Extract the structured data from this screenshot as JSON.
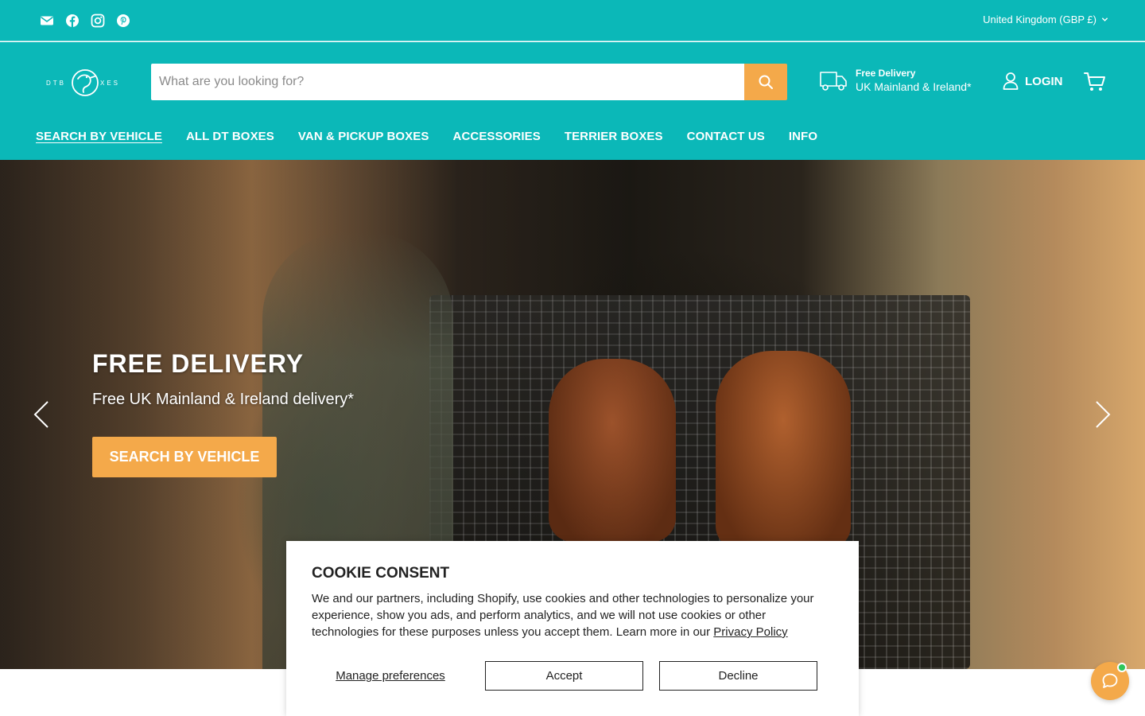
{
  "topbar": {
    "social_icons": [
      "email-icon",
      "facebook-icon",
      "instagram-icon",
      "pinterest-icon"
    ],
    "country_selector": "United Kingdom (GBP £)"
  },
  "header": {
    "logo_alt": "DT BOXES",
    "search_placeholder": "What are you looking for?",
    "delivery_title": "Free Delivery",
    "delivery_subtitle": "UK Mainland & Ireland*",
    "login_label": "LOGIN"
  },
  "nav": {
    "items": [
      {
        "label": "SEARCH BY VEHICLE",
        "active": true
      },
      {
        "label": "ALL DT BOXES",
        "active": false
      },
      {
        "label": "VAN & PICKUP BOXES",
        "active": false
      },
      {
        "label": "ACCESSORIES",
        "active": false
      },
      {
        "label": "TERRIER BOXES",
        "active": false
      },
      {
        "label": "CONTACT US",
        "active": false
      },
      {
        "label": "INFO",
        "active": false
      }
    ]
  },
  "hero": {
    "title": "FREE DELIVERY",
    "subtitle": "Free UK Mainland & Ireland delivery*",
    "cta_label": "SEARCH BY VEHICLE"
  },
  "cookie": {
    "title": "COOKIE CONSENT",
    "body": "We and our partners, including Shopify, use cookies and other technologies to personalize your experience, show you ads, and perform analytics, and we will not use cookies or other technologies for these purposes unless you accept them. Learn more in our ",
    "policy_link": "Privacy Policy",
    "manage_label": "Manage preferences",
    "accept_label": "Accept",
    "decline_label": "Decline"
  },
  "colors": {
    "brand_teal": "#0bb8b8",
    "accent_orange": "#f4a94a",
    "online_green": "#2ec65a"
  }
}
